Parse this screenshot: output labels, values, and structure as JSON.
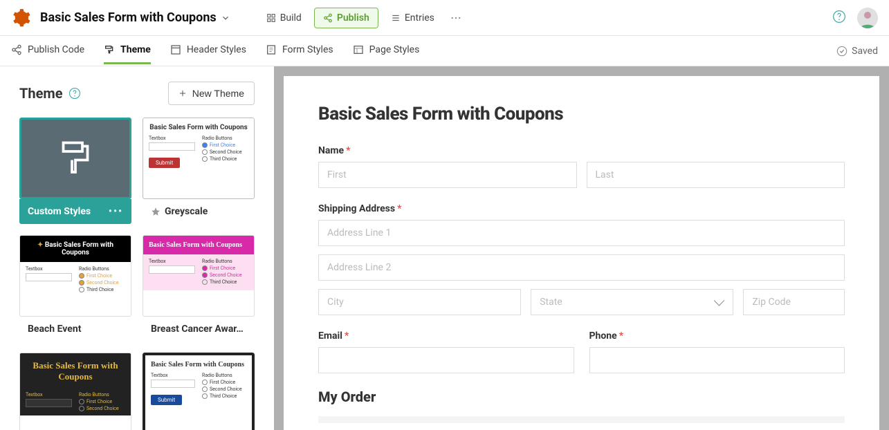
{
  "header": {
    "app_title": "Basic Sales Form with Coupons",
    "build": "Build",
    "publish": "Publish",
    "entries": "Entries",
    "saved": "Saved"
  },
  "tabs": {
    "publish_code": "Publish Code",
    "theme": "Theme",
    "header_styles": "Header Styles",
    "form_styles": "Form Styles",
    "page_styles": "Page Styles"
  },
  "sidebar": {
    "title": "Theme",
    "new_theme": "New Theme",
    "themes": [
      {
        "label": "Custom Styles"
      },
      {
        "label": "Greyscale"
      },
      {
        "label": "Beach Event"
      },
      {
        "label": "Breast Cancer Awar…"
      }
    ],
    "mini": {
      "title": "Basic Sales Form with Coupons",
      "textbox": "Textbox",
      "radio_head": "Radio Buttons",
      "first_choice": "First Choice",
      "second_choice": "Second Choice",
      "third_choice": "Third Choice",
      "submit": "Submit"
    }
  },
  "form": {
    "title": "Basic Sales Form with Coupons",
    "labels": {
      "name": "Name",
      "shipping": "Shipping Address",
      "email": "Email",
      "phone": "Phone",
      "order": "My Order"
    },
    "placeholders": {
      "first": "First",
      "last": "Last",
      "addr1": "Address Line 1",
      "addr2": "Address Line 2",
      "city": "City",
      "state": "State",
      "zip": "Zip Code"
    }
  }
}
